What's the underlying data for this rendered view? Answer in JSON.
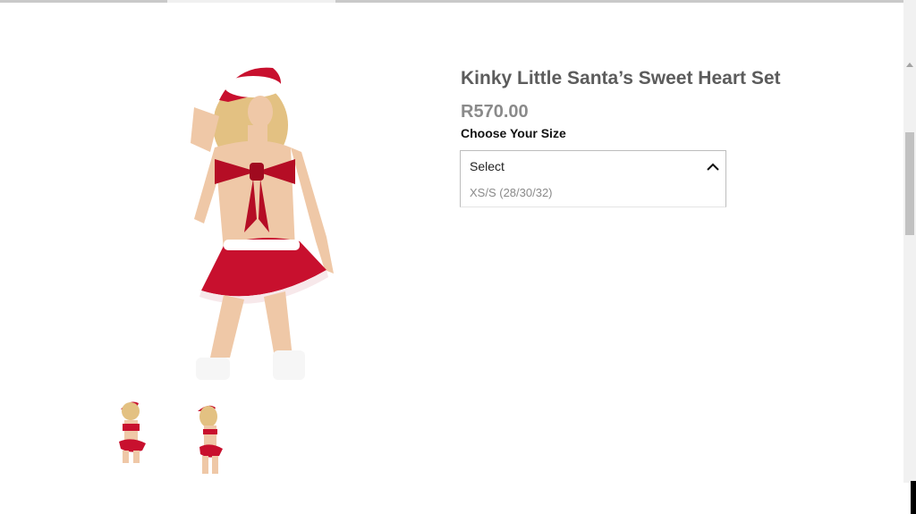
{
  "product": {
    "title": "Kinky Little Santa’s Sweet Heart Set",
    "price": "R570.00",
    "size_label": "Choose Your Size",
    "size_select": {
      "selected": "Select",
      "options": [
        "XS/S (28/30/32)"
      ]
    },
    "main_image": "santa-outfit-model-front",
    "thumbnails": [
      "santa-outfit-front-thumb",
      "santa-outfit-back-thumb"
    ]
  },
  "colors": {
    "red": "#c8102e",
    "title_gray": "#5c5c5c",
    "price_gray": "#8a8a8a"
  },
  "icons": {
    "dropdown": "chevron-up-icon"
  }
}
